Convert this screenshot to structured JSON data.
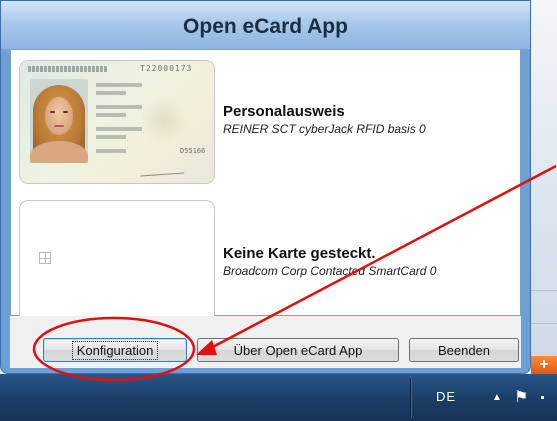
{
  "window": {
    "title": "Open eCard App"
  },
  "cards": [
    {
      "name": "Personalausweis",
      "reader": "REINER SCT cyberJack RFID basis 0",
      "image_icon": "german-id-card-icon",
      "card_number_text": "T22000173",
      "card_code_text": "D55166"
    },
    {
      "name": "Keine Karte gesteckt.",
      "reader": "Broadcom Corp Contacted SmartCard 0",
      "image_icon": "smartcard-chip-icon"
    }
  ],
  "buttons": {
    "config": "Konfiguration",
    "about": "Über Open eCard App",
    "quit": "Beenden"
  },
  "taskbar": {
    "language": "DE",
    "tray_icons": [
      "show-hidden-icons-icon",
      "action-center-flag-icon",
      "network-icon"
    ]
  },
  "background_window": {
    "orange_button_label": "+"
  },
  "annotation": {
    "color": "#e01010",
    "target": "Konfiguration"
  }
}
